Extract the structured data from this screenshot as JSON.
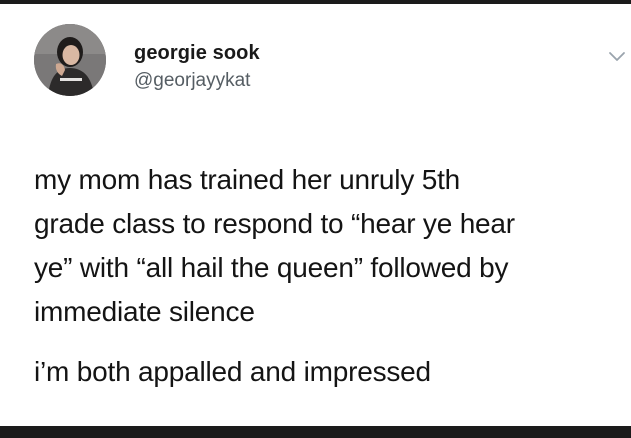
{
  "user": {
    "display_name": "georgie sook",
    "handle": "@georjayykat"
  },
  "tweet": {
    "lines_p1": [
      "my mom has trained her unruly 5th",
      "grade class to respond to “hear ye hear",
      "ye” with “all hail the queen” followed by",
      "immediate silence"
    ],
    "lines_p2": [
      "i’m both appalled and impressed"
    ]
  },
  "icons": {
    "avatar": "profile-photo",
    "menu": "chevron-down-icon"
  },
  "colors": {
    "card_bg": "#ffffff",
    "page_bg": "#1b1b1b",
    "text": "#141414",
    "muted": "#555d63",
    "chevron": "#9aa4ad"
  }
}
